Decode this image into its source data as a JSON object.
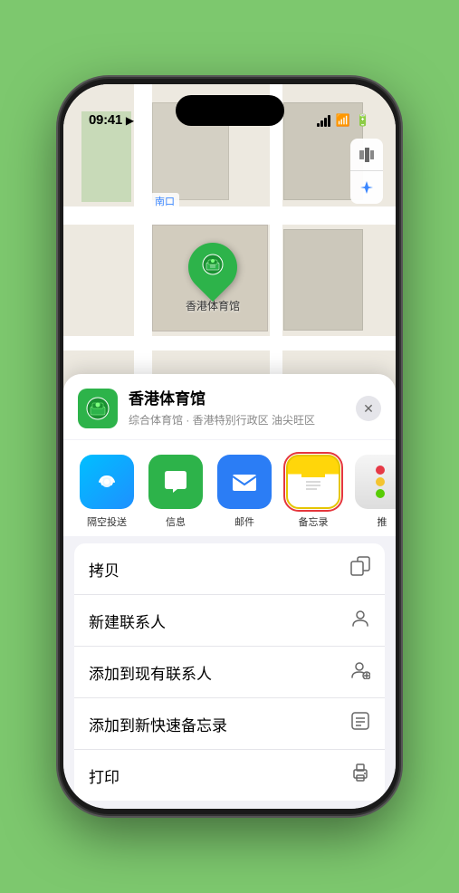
{
  "status_bar": {
    "time": "09:41",
    "location_arrow": "▶"
  },
  "map": {
    "label": "南口",
    "pin_label": "香港体育馆",
    "controls": {
      "map_icon": "🗺",
      "location_icon": "⬆"
    }
  },
  "venue": {
    "name": "香港体育馆",
    "subtitle": "综合体育馆 · 香港特别行政区 油尖旺区",
    "icon": "🏟"
  },
  "share_items": [
    {
      "id": "airdrop",
      "icon": "📡",
      "label": "隔空投送",
      "type": "airdrop"
    },
    {
      "id": "messages",
      "icon": "💬",
      "label": "信息",
      "type": "messages"
    },
    {
      "id": "mail",
      "icon": "✉",
      "label": "邮件",
      "type": "mail"
    },
    {
      "id": "notes",
      "icon": "📝",
      "label": "备忘录",
      "type": "notes",
      "selected": true
    },
    {
      "id": "more",
      "icon": "⋯",
      "label": "推",
      "type": "more"
    }
  ],
  "actions": [
    {
      "id": "copy",
      "label": "拷贝",
      "icon": "⿰"
    },
    {
      "id": "new-contact",
      "label": "新建联系人",
      "icon": "👤"
    },
    {
      "id": "add-contact",
      "label": "添加到现有联系人",
      "icon": "👤"
    },
    {
      "id": "quick-note",
      "label": "添加到新快速备忘录",
      "icon": "📋"
    },
    {
      "id": "print",
      "label": "打印",
      "icon": "🖨"
    }
  ],
  "close_label": "✕"
}
